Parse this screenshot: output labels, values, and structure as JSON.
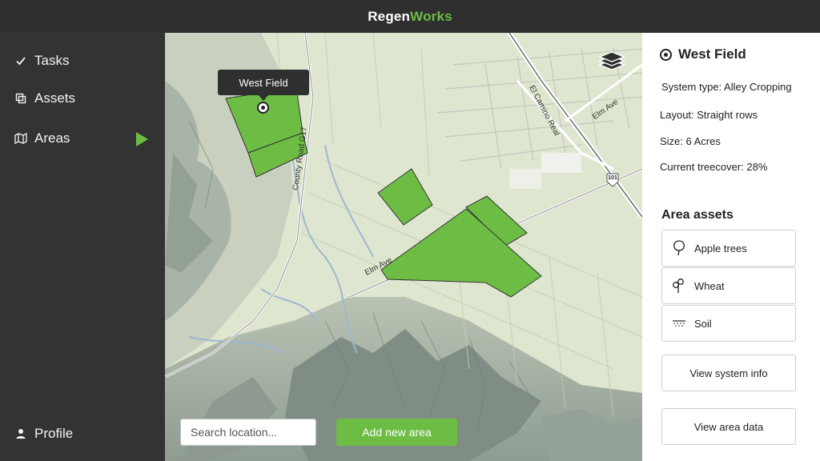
{
  "app": {
    "brand_primary": "Regen",
    "brand_accent": "Works",
    "accent_color": "#6dbd45"
  },
  "sidebar": {
    "items": [
      {
        "label": "Tasks",
        "icon": "checkmark-icon"
      },
      {
        "label": "Assets",
        "icon": "assets-icon"
      },
      {
        "label": "Areas",
        "icon": "map-icon",
        "active": true
      }
    ],
    "profile": {
      "label": "Profile",
      "icon": "user-icon"
    }
  },
  "map": {
    "tooltip": "West Field",
    "labels": {
      "county_road": "County Road G17",
      "elm_ave_west": "Elm Ave",
      "el_camino": "El Camino Real",
      "elm_ave_east": "Elm Ave",
      "highway": "101"
    },
    "search": {
      "placeholder": "Search location..."
    },
    "add_area_label": "Add new area"
  },
  "panel": {
    "title": "West Field",
    "properties": [
      "System type: Alley Cropping",
      "Layout: Straight rows",
      "Size: 6 Acres",
      "Current treecover: 28%"
    ],
    "assets_title": "Area assets",
    "assets": [
      {
        "label": "Apple trees",
        "icon": "tree-icon"
      },
      {
        "label": "Wheat",
        "icon": "wheat-icon"
      },
      {
        "label": "Soil",
        "icon": "soil-icon"
      }
    ],
    "view_system_label": "View system info",
    "view_area_label": "View area data"
  }
}
